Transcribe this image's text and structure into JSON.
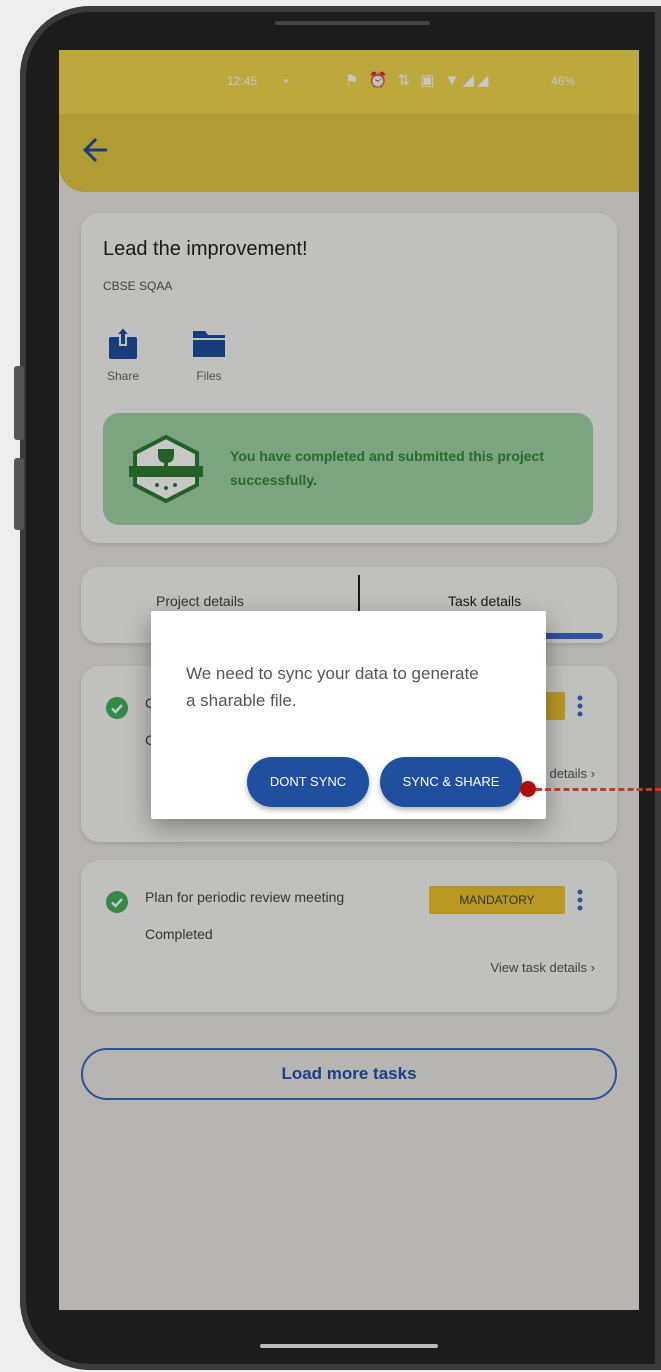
{
  "status_bar": {
    "time": "12:45",
    "dot": "•",
    "icons": "⚑ ⏰ ⇅ ▣ ▼◢◢",
    "battery": "46%"
  },
  "project": {
    "title": "Lead the improvement!",
    "subtitle": "CBSE SQAA",
    "actions": [
      {
        "label": "Share"
      },
      {
        "label": "Files"
      }
    ],
    "banner": {
      "text": "You have completed and submitted this project successfully."
    }
  },
  "tabs": [
    {
      "label": "Project details"
    },
    {
      "label": "Task details"
    }
  ],
  "tasks": [
    {
      "title": "C",
      "status": "C",
      "tag": "",
      "link": "View task details"
    },
    {
      "title": "Plan for periodic review meeting",
      "status": "Completed",
      "tag": "MANDATORY",
      "link": "View task details"
    }
  ],
  "load_more_label": "Load more tasks",
  "dialog": {
    "message": "We need to sync your data to generate a sharable file.",
    "dont_sync_label": "DONT SYNC",
    "sync_share_label": "SYNC & SHARE"
  },
  "colors": {
    "accent": "#f1d74f",
    "primary_button": "#1f4f9e",
    "success": "#2e8b3a",
    "tag": "#ecc22c",
    "annotation": "#b00a0a"
  }
}
